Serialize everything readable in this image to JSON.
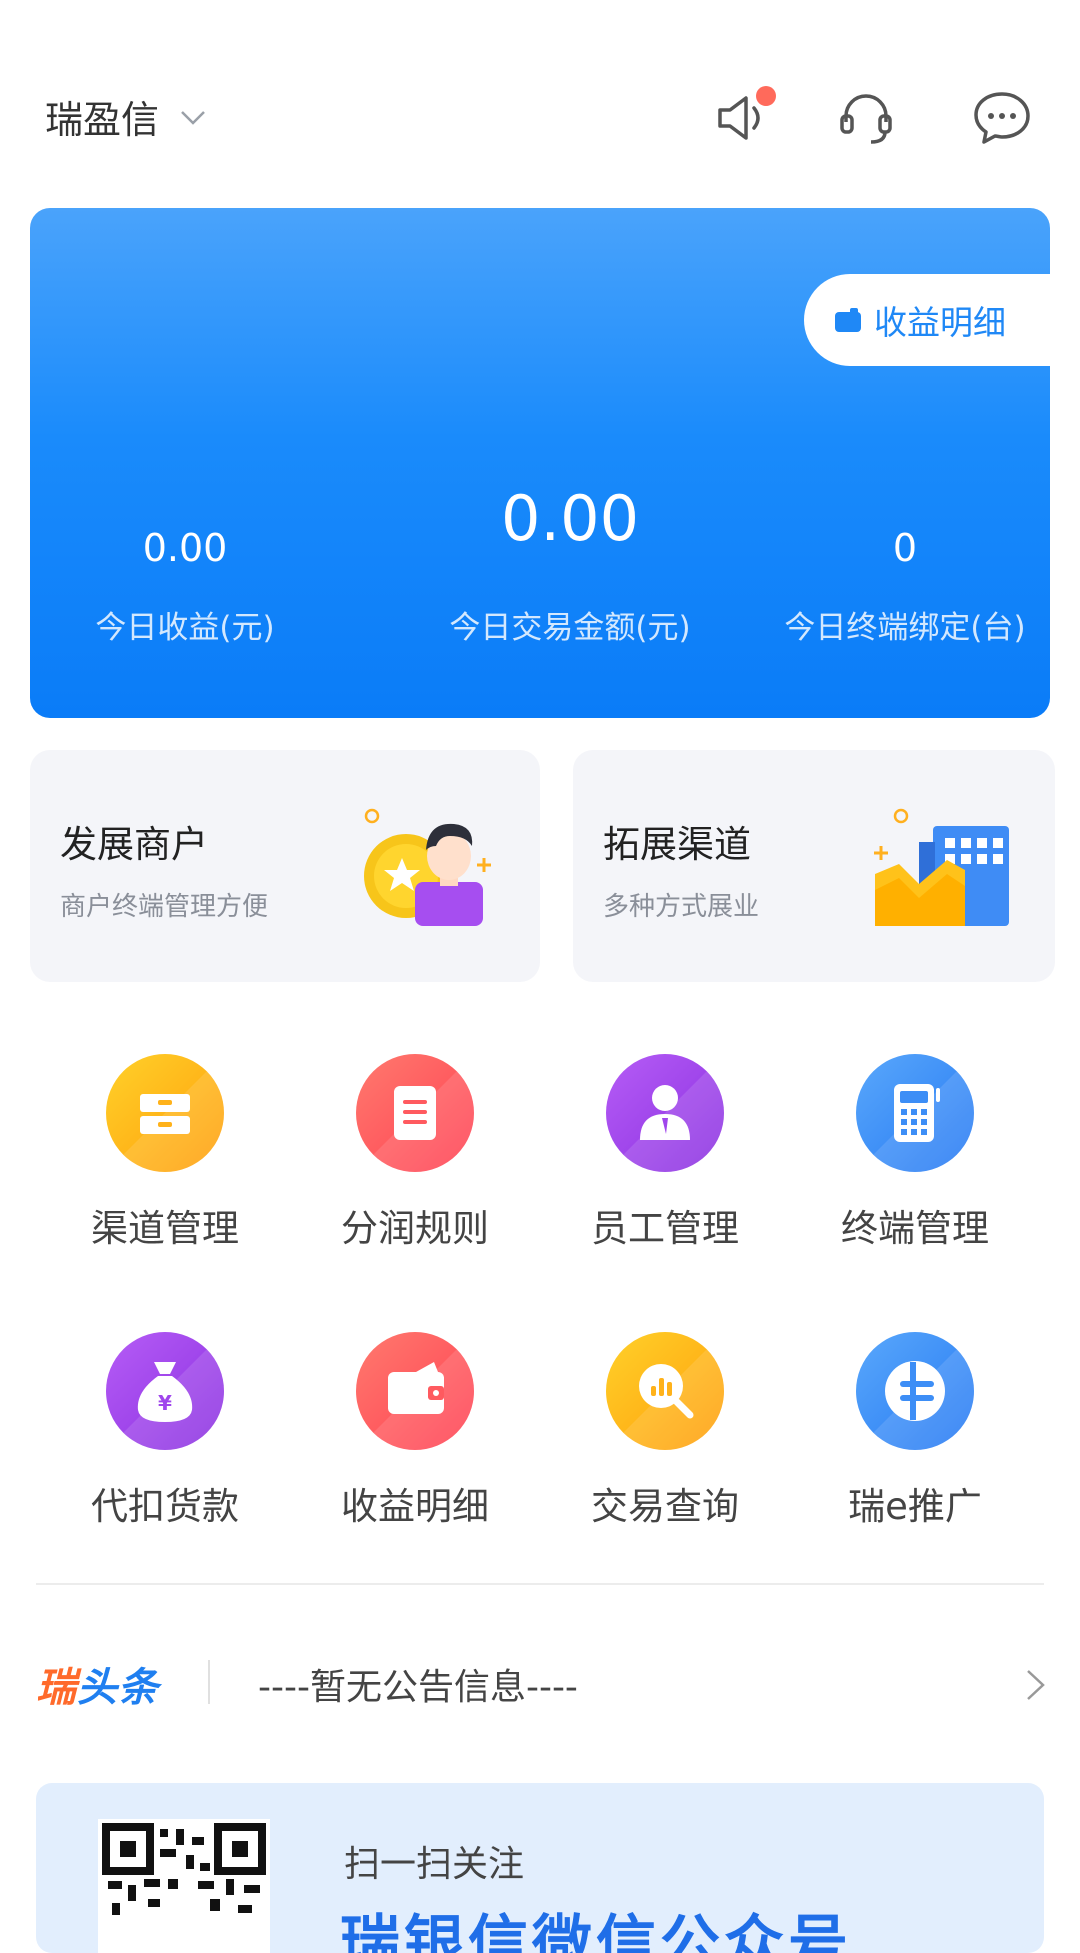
{
  "header": {
    "org_name": "瑞盈信",
    "icons": [
      "speaker-icon",
      "headset-icon",
      "chat-icon"
    ],
    "has_notification": true
  },
  "stats": {
    "earnings_detail_label": "收益明细",
    "today_income_value": "0.00",
    "today_income_label": "今日收益(元)",
    "today_trade_value": "0.00",
    "today_trade_label": "今日交易金额(元)",
    "today_terminal_value": "0",
    "today_terminal_label": "今日终端绑定(台)"
  },
  "features": [
    {
      "title": "发展商户",
      "subtitle": "商户终端管理方便",
      "icon": "merchant-illustration-icon"
    },
    {
      "title": "拓展渠道",
      "subtitle": "多种方式展业",
      "icon": "channel-illustration-icon"
    }
  ],
  "grid": [
    {
      "label": "渠道管理",
      "icon": "cabinet-icon"
    },
    {
      "label": "分润规则",
      "icon": "document-icon"
    },
    {
      "label": "员工管理",
      "icon": "employee-icon"
    },
    {
      "label": "终端管理",
      "icon": "pos-terminal-icon"
    },
    {
      "label": "代扣货款",
      "icon": "money-bag-icon"
    },
    {
      "label": "收益明细",
      "icon": "wallet-icon"
    },
    {
      "label": "交易查询",
      "icon": "search-chart-icon"
    },
    {
      "label": "瑞e推广",
      "icon": "globe-icon"
    }
  ],
  "news": {
    "brand_part1": "瑞",
    "brand_part2": "头条",
    "text": "----暂无公告信息----"
  },
  "banner": {
    "subtitle": "扫一扫关注",
    "title": "瑞银信微信公众号"
  },
  "colors": {
    "primary": "#1f88f6",
    "card_top": "#4aa3fb",
    "card_bottom": "#0a7cf8",
    "news_orange": "#ff6a2b",
    "news_blue": "#1f7ff0"
  }
}
